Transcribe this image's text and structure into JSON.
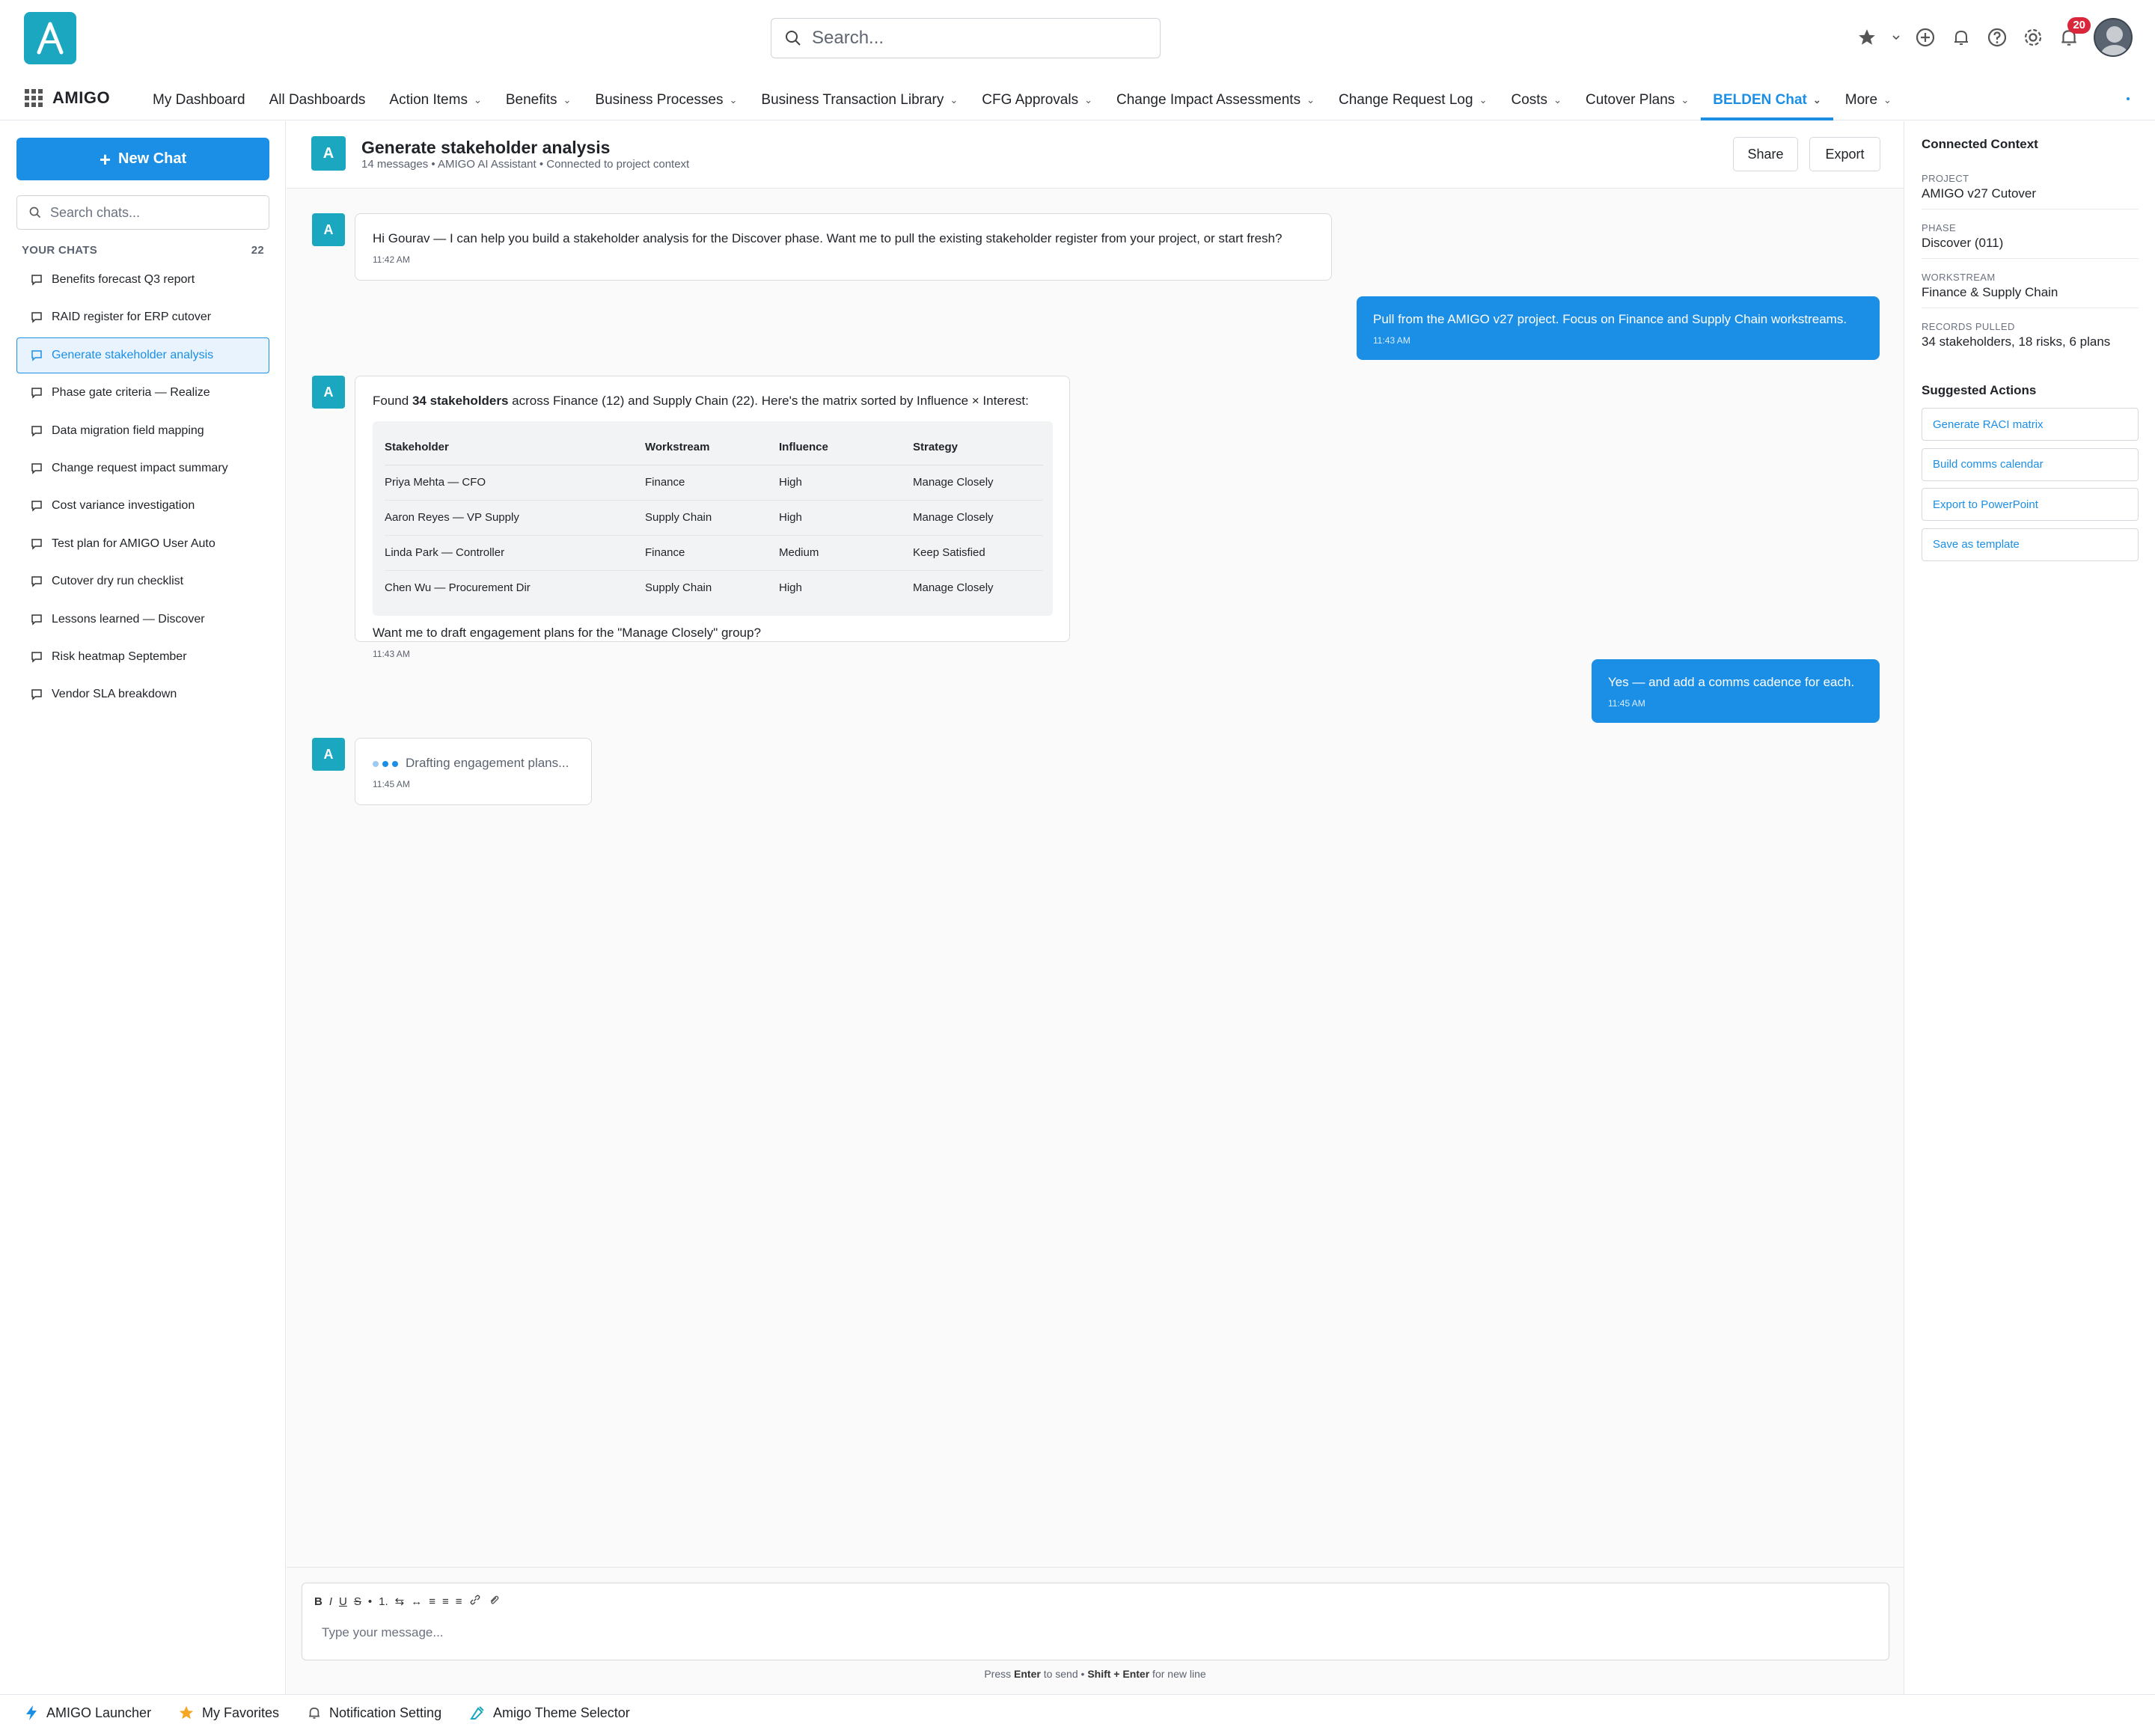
{
  "app": {
    "logo_letter": "A",
    "brand": "AMIGO"
  },
  "search": {
    "placeholder": "Search..."
  },
  "top_icons": [
    "star-icon",
    "chevron-down-icon",
    "plus-circle-icon",
    "bell-outline-icon",
    "help-icon",
    "settings-icon",
    "notifications-icon"
  ],
  "notifications": {
    "count": "20"
  },
  "nav": {
    "items": [
      {
        "label": "My Dashboard"
      },
      {
        "label": "All Dashboards"
      },
      {
        "label": "Action Items",
        "chevron": "⌄"
      },
      {
        "label": "Benefits",
        "chevron": "⌄"
      },
      {
        "label": "Business Processes",
        "chevron": "⌄"
      },
      {
        "label": "Business Transaction Library",
        "chevron": "⌄"
      },
      {
        "label": "CFG Approvals",
        "chevron": "⌄"
      },
      {
        "label": "Change Impact Assessments",
        "chevron": "⌄"
      },
      {
        "label": "Change Request Log",
        "chevron": "⌄"
      },
      {
        "label": "Costs",
        "chevron": "⌄"
      },
      {
        "label": "Cutover Plans",
        "chevron": "⌄"
      },
      {
        "label": "BELDEN Chat",
        "chevron": "⌄",
        "active": true
      },
      {
        "label": "More",
        "chevron": "⌄"
      }
    ]
  },
  "sidebar": {
    "new_chat": "New Chat",
    "new_chat_plus": "+",
    "search_placeholder": "Search chats...",
    "section_label": "YOUR CHATS",
    "section_count": "22",
    "chats": [
      "Benefits forecast Q3 report",
      "RAID register for ERP cutover",
      "Generate stakeholder analysis",
      "Phase gate criteria — Realize",
      "Data migration field mapping",
      "Change request impact summary",
      "Cost variance investigation",
      "Test plan for AMIGO User Auto",
      "Cutover dry run checklist",
      "Lessons learned — Discover",
      "Risk heatmap September",
      "Vendor SLA breakdown"
    ],
    "active_index": 2
  },
  "chat": {
    "avatar": "A",
    "title": "Generate stakeholder analysis",
    "subtitle": "14 messages • AMIGO AI Assistant • Connected to project context",
    "share": "Share",
    "export": "Export",
    "messages": {
      "m1": {
        "text": "Hi Gourav — I can help you build a stakeholder analysis for the Discover phase. Want me to pull the existing stakeholder register from your project, or start fresh?",
        "time": "11:42 AM"
      },
      "m2": {
        "text": "Pull from the AMIGO v27 project. Focus on Finance and Supply Chain workstreams.",
        "time": "11:43 AM"
      },
      "m3": {
        "intro_pre": "Found ",
        "intro_bold": "34 stakeholders",
        "intro_post": " across Finance (12) and Supply Chain (22). Here's the matrix sorted by Influence × Interest:",
        "columns": [
          "Stakeholder",
          "Workstream",
          "Influence",
          "Strategy"
        ],
        "rows": [
          [
            "Priya Mehta — CFO",
            "Finance",
            "High",
            "Manage Closely"
          ],
          [
            "Aaron Reyes — VP Supply",
            "Supply Chain",
            "High",
            "Manage Closely"
          ],
          [
            "Linda Park — Controller",
            "Finance",
            "Medium",
            "Keep Satisfied"
          ],
          [
            "Chen Wu — Procurement Dir",
            "Supply Chain",
            "High",
            "Manage Closely"
          ]
        ],
        "outro": "Want me to draft engagement plans for the \"Manage Closely\" group?",
        "time": "11:43 AM"
      },
      "m4": {
        "text": "Yes — and add a comms cadence for each.",
        "time": "11:45 AM"
      },
      "m5": {
        "text": "Drafting engagement plans...",
        "time": "11:45 AM"
      }
    },
    "composer": {
      "placeholder": "Type your message...",
      "toolbar": [
        "B",
        "I",
        "U",
        "S",
        "•",
        "1.",
        "⇆",
        "↔",
        "≡",
        "≡",
        "≡"
      ],
      "hint_press": "Press ",
      "hint_enter": "Enter",
      "hint_send": " to send • ",
      "hint_shift": "Shift + Enter",
      "hint_newline": " for new line"
    }
  },
  "context_panel": {
    "title": "Connected Context",
    "fields": [
      {
        "label": "PROJECT",
        "value": "AMIGO v27 Cutover"
      },
      {
        "label": "PHASE",
        "value": "Discover (011)"
      },
      {
        "label": "WORKSTREAM",
        "value": "Finance & Supply Chain"
      },
      {
        "label": "RECORDS PULLED",
        "value": "34 stakeholders, 18 risks, 6 plans"
      }
    ],
    "actions_title": "Suggested Actions",
    "actions": [
      "Generate RACI matrix",
      "Build comms calendar",
      "Export to PowerPoint",
      "Save as template"
    ]
  },
  "footer": {
    "items": [
      {
        "label": "AMIGO Launcher",
        "icon": "bolt-icon"
      },
      {
        "label": "My Favorites",
        "icon": "star-icon"
      },
      {
        "label": "Notification Setting",
        "icon": "bell-icon"
      },
      {
        "label": "Amigo Theme Selector",
        "icon": "palette-icon"
      }
    ]
  },
  "colors": {
    "accent": "#1b8fe6",
    "logo": "#1ba7c0",
    "badge": "#d9263a",
    "favorite": "#f5a623"
  }
}
